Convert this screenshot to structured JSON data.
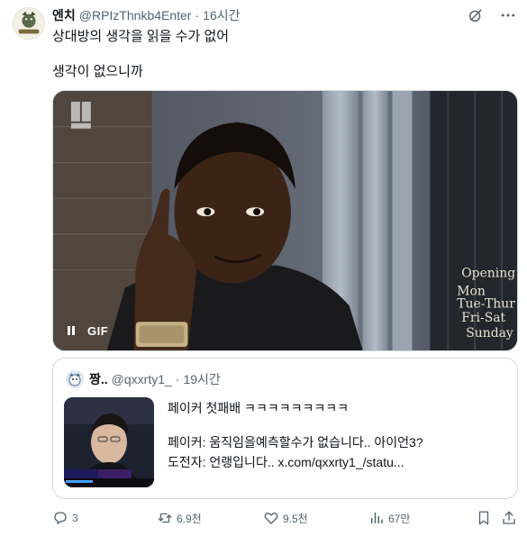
{
  "tweet": {
    "author_name": "엔치",
    "handle": "@RPIzThnkb4Enter",
    "separator": "·",
    "time": "16시간",
    "text_line1": "상대방의 생각을 읽을 수가 없어",
    "text_line2": "생각이 없으니까"
  },
  "media": {
    "gif_label": "GIF",
    "icon": "pause-icon"
  },
  "quote": {
    "author_name": "짱..",
    "handle": "@qxxrty1_",
    "separator": "·",
    "time": "19시간",
    "line1": "페이커 첫패배 ㅋㅋㅋㅋㅋㅋㅋㅋㅋ",
    "line2": "페이커: 움직임을예측할수가 없습니다.. 아이언3?",
    "line3": "도전자: 언랭입니다..  x.com/qxxrty1_/statu..."
  },
  "actions": {
    "replies": "3",
    "retweets": "6.9천",
    "likes": "9.5천",
    "views": "67만"
  },
  "colors": {
    "text": "#0f1419",
    "secondary": "#536471",
    "border": "#cfd9de"
  }
}
